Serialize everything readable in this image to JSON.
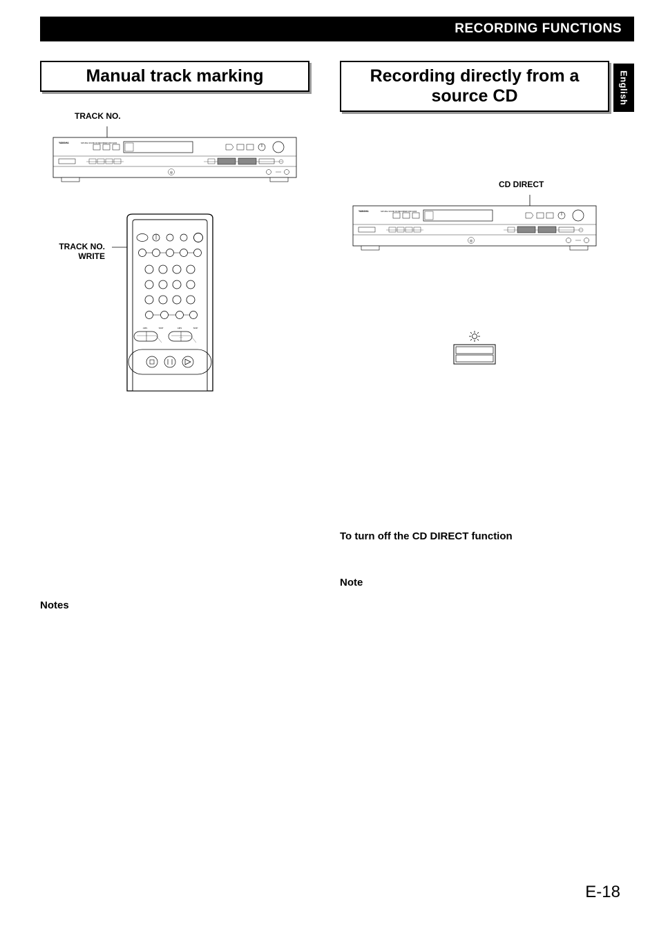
{
  "header": {
    "title": "RECORDING FUNCTIONS"
  },
  "sideTab": {
    "label": "English"
  },
  "leftColumn": {
    "title": "Manual track marking",
    "deviceCallout": "TRACK NO.",
    "remoteCallout": "TRACK NO.\nWRITE",
    "notesLabel": "Notes",
    "brand": "YAMAHA",
    "modelLine": "NATURAL SOUND CD RECORDER  CDR-S1000"
  },
  "rightColumn": {
    "title": "Recording directly from a source CD",
    "deviceCallout": "CD DIRECT",
    "subHeading": "To turn off the CD DIRECT function",
    "noteLabel": "Note",
    "brand": "YAMAHA",
    "modelLine": "NATURAL SOUND CD RECORDER  CDR-S1000"
  },
  "pageNumber": "E-18"
}
